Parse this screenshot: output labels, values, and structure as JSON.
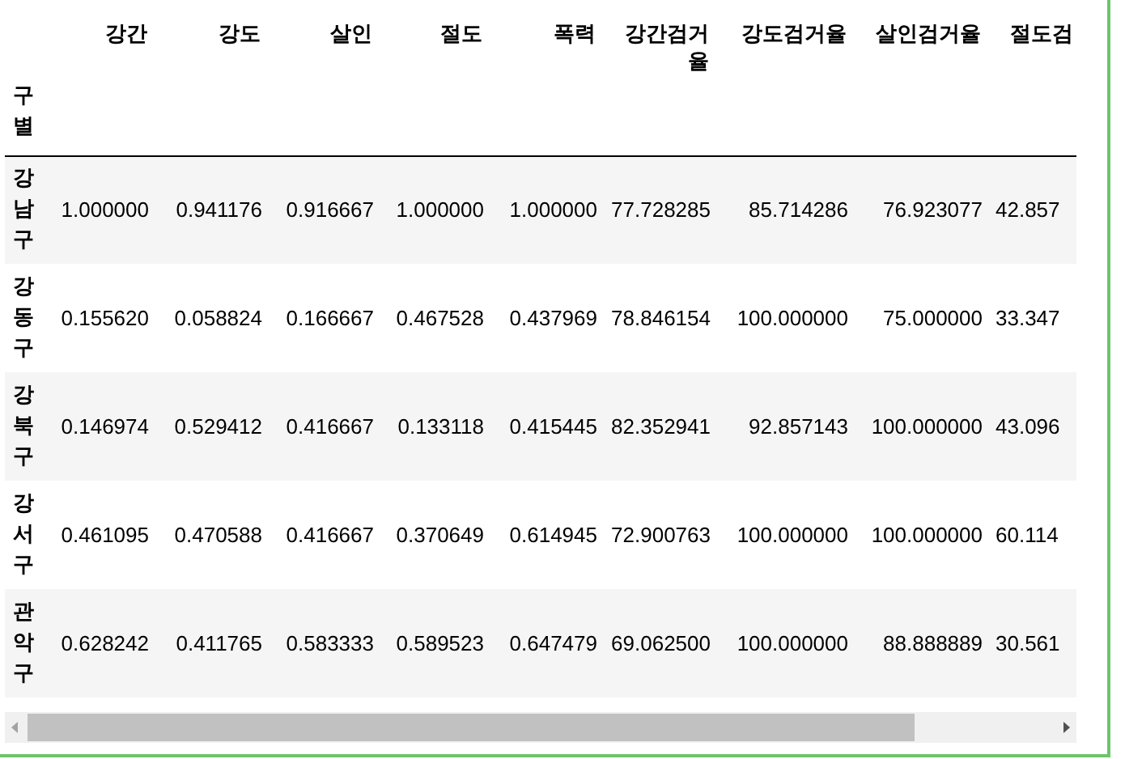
{
  "table": {
    "index_name": "구별",
    "columns": [
      "강간",
      "강도",
      "살인",
      "절도",
      "폭력",
      "강간검거율",
      "강도검거율",
      "살인검거율",
      "절도검"
    ],
    "rows": [
      {
        "label": "강남구",
        "values": [
          "1.000000",
          "0.941176",
          "0.916667",
          "1.000000",
          "1.000000",
          "77.728285",
          "85.714286",
          "76.923077",
          "42.857"
        ]
      },
      {
        "label": "강동구",
        "values": [
          "0.155620",
          "0.058824",
          "0.166667",
          "0.467528",
          "0.437969",
          "78.846154",
          "100.000000",
          "75.000000",
          "33.347"
        ]
      },
      {
        "label": "강북구",
        "values": [
          "0.146974",
          "0.529412",
          "0.416667",
          "0.133118",
          "0.415445",
          "82.352941",
          "92.857143",
          "100.000000",
          "43.096"
        ]
      },
      {
        "label": "강서구",
        "values": [
          "0.461095",
          "0.470588",
          "0.416667",
          "0.370649",
          "0.614945",
          "72.900763",
          "100.000000",
          "100.000000",
          "60.114"
        ]
      },
      {
        "label": "관악구",
        "values": [
          "0.628242",
          "0.411765",
          "0.583333",
          "0.589523",
          "0.647479",
          "69.062500",
          "100.000000",
          "88.888889",
          "30.561"
        ]
      }
    ]
  }
}
